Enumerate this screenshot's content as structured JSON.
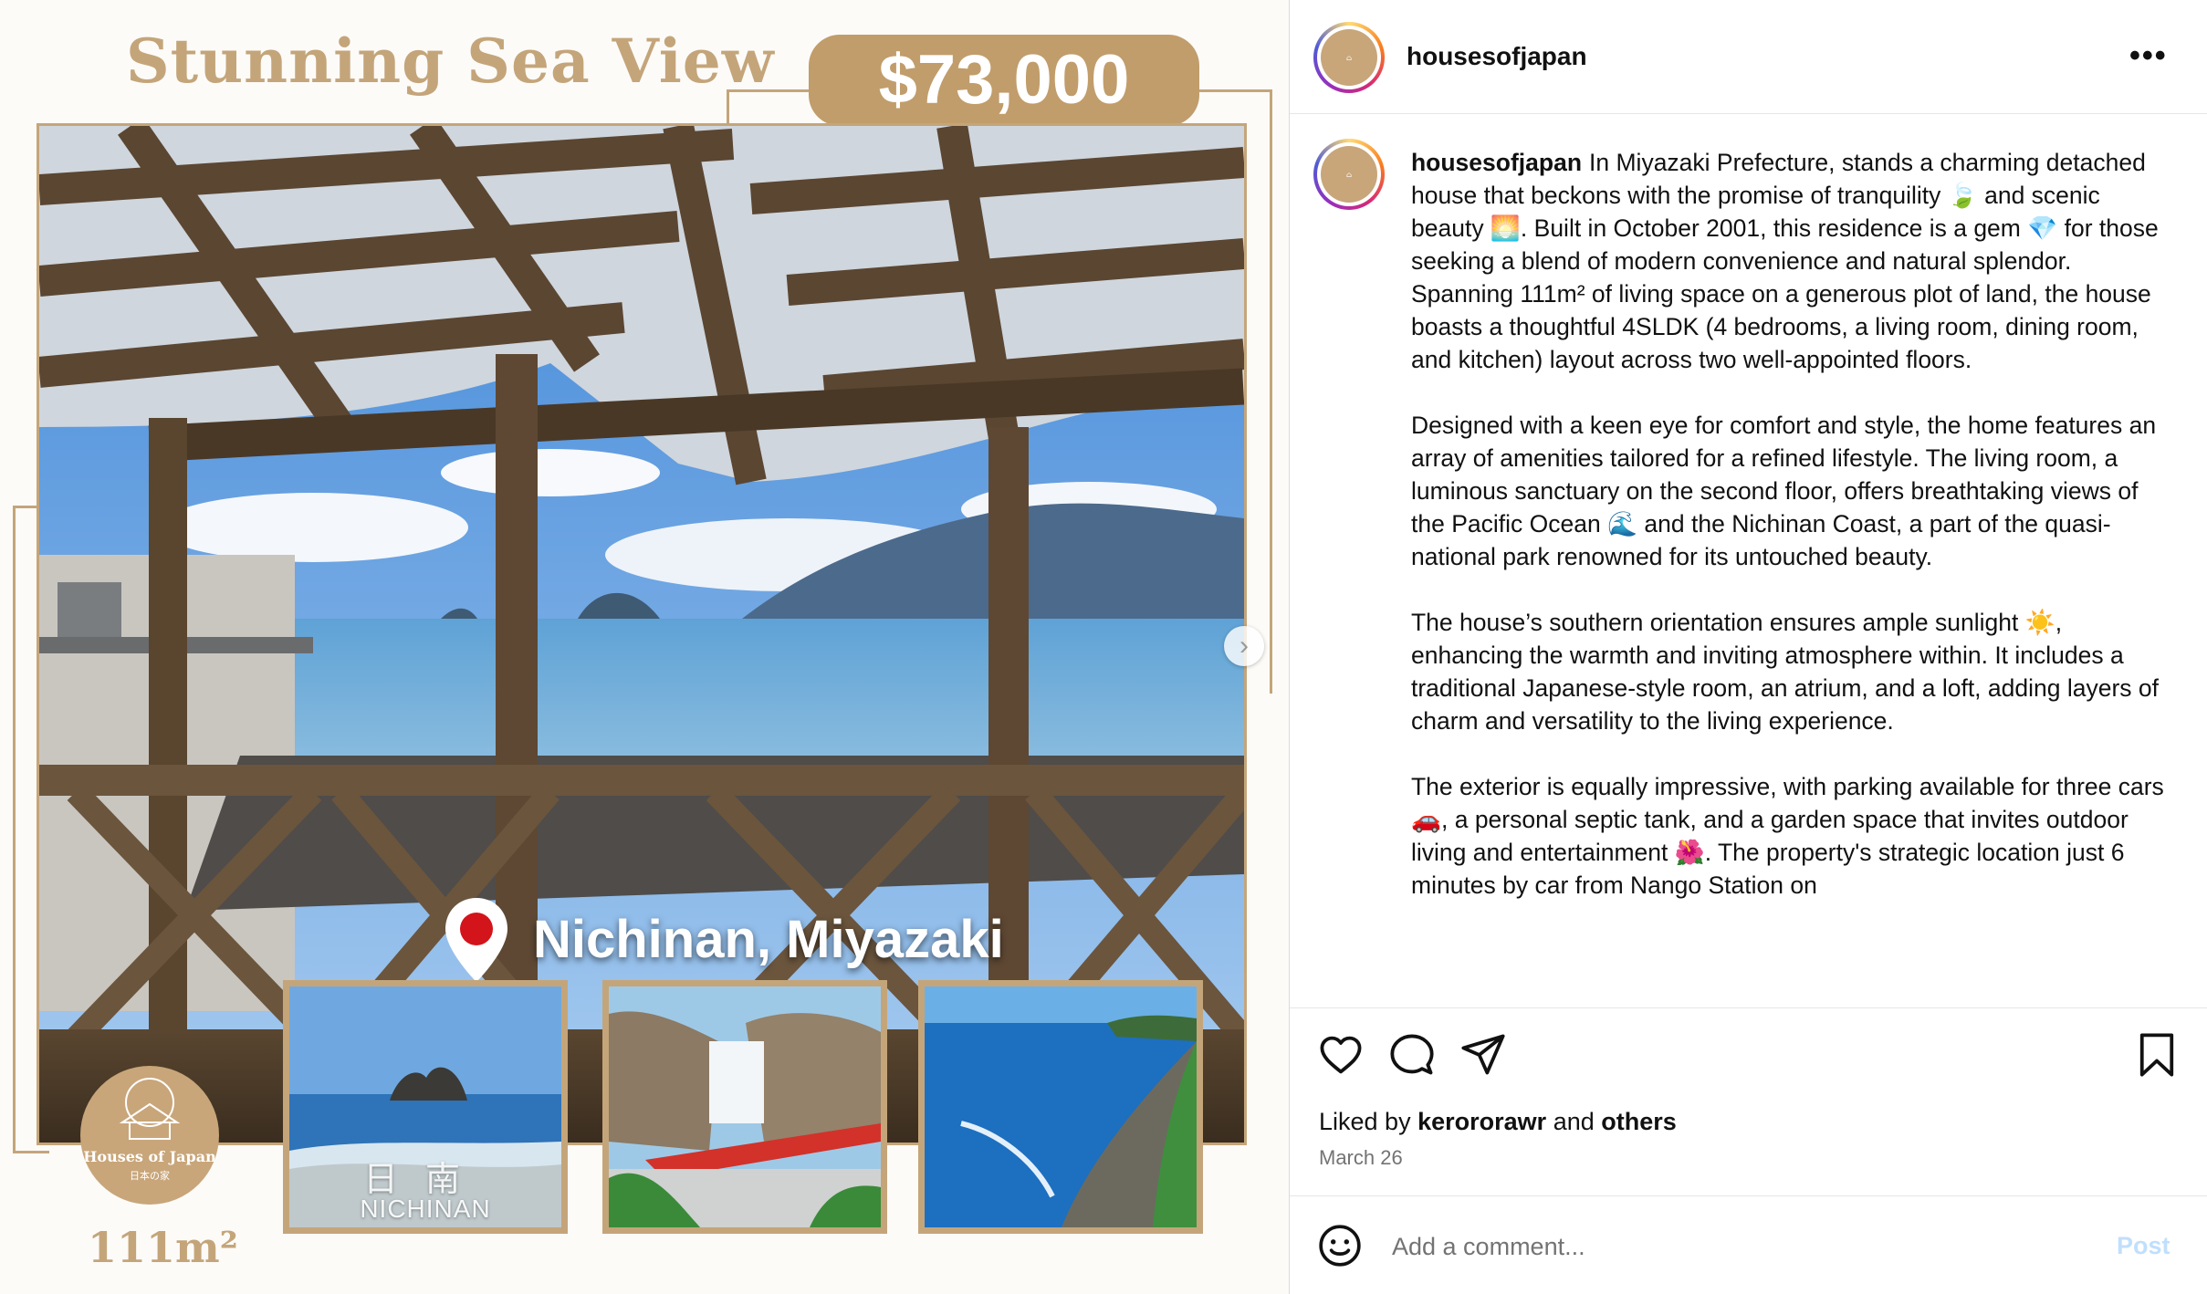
{
  "listing": {
    "headline": "Stunning Sea View",
    "price": "$73,000",
    "location": "Nichinan, Miyazaki",
    "area": "111m²",
    "brand_name": "Houses of Japan",
    "brand_name_jp": "日本の家",
    "thumbnail_caption_jp": "日南",
    "thumbnail_caption_en": "NICHINAN"
  },
  "post": {
    "username": "housesofjapan",
    "more_label": "•••",
    "caption_paragraphs": [
      "In Miyazaki Prefecture, stands a charming detached house that beckons with the promise of tranquility 🍃 and scenic beauty 🌅. Built in October 2001, this residence is a gem 💎 for those seeking a blend of modern convenience and natural splendor. Spanning 111m² of living space on a generous plot of land, the house boasts a thoughtful 4SLDK (4 bedrooms, a living room, dining room, and kitchen) layout across two well-appointed floors.",
      "Designed with a keen eye for comfort and style, the home features an array of amenities tailored for a refined lifestyle. The living room, a luminous sanctuary on the second floor, offers breathtaking views of the Pacific Ocean 🌊 and the Nichinan Coast, a part of the quasi-national park renowned for its untouched beauty.",
      "The house’s southern orientation ensures ample sunlight ☀️, enhancing the warmth and inviting atmosphere within. It includes a traditional Japanese-style room, an atrium, and a loft, adding layers of charm and versatility to the living experience.",
      "The exterior is equally impressive, with parking available for three cars 🚗, a personal septic tank, and a garden space that invites outdoor living and entertainment 🌺. The property's strategic location just 6 minutes by car from Nango Station on"
    ],
    "liked_by_prefix": "Liked by",
    "liked_by_user": "kerororawr",
    "liked_by_and": "and",
    "liked_by_others": "others",
    "date": "March 26",
    "comment_placeholder": "Add a comment...",
    "post_label": "Post"
  },
  "icons": [
    "heart-icon",
    "comment-icon",
    "share-icon",
    "bookmark-icon",
    "emoji-icon",
    "chevron-right-icon",
    "map-pin-icon"
  ],
  "colors": {
    "gold": "#c4a57a",
    "price_tag": "#c19d6b",
    "post_button_disabled": "#c0dffd",
    "secondary_text": "#737373"
  }
}
